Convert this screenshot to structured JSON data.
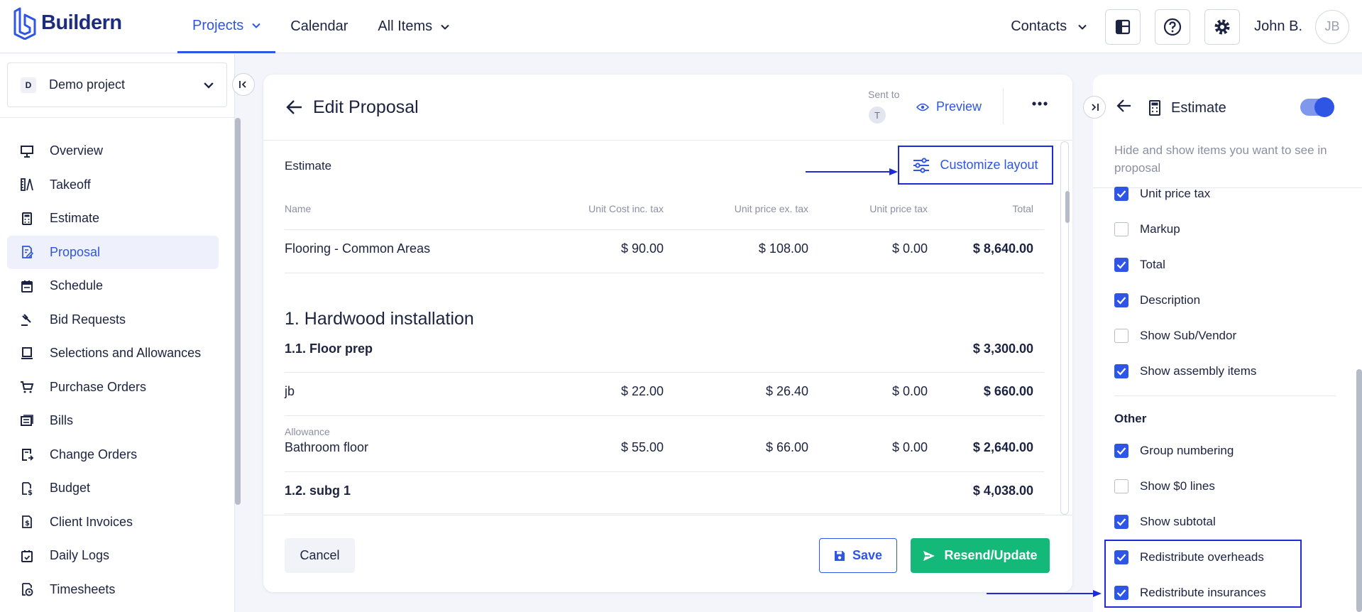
{
  "brand": {
    "name": "Buildern",
    "color": "#1d2d7c"
  },
  "nav": {
    "projects": "Projects",
    "calendar": "Calendar",
    "all_items": "All Items",
    "contacts": "Contacts",
    "user_name": "John B.",
    "user_initials": "JB"
  },
  "sidebar": {
    "project_badge": "D",
    "project_name": "Demo project",
    "items": [
      {
        "label": "Overview",
        "icon": "board-icon"
      },
      {
        "label": "Takeoff",
        "icon": "ruler-icon"
      },
      {
        "label": "Estimate",
        "icon": "calculator-icon"
      },
      {
        "label": "Proposal",
        "icon": "document-pen-icon",
        "active": true
      },
      {
        "label": "Schedule",
        "icon": "calendar-icon"
      },
      {
        "label": "Bid Requests",
        "icon": "gavel-icon"
      },
      {
        "label": "Selections and Allowances",
        "icon": "selection-icon"
      },
      {
        "label": "Purchase Orders",
        "icon": "cart-icon"
      },
      {
        "label": "Bills",
        "icon": "bills-icon"
      },
      {
        "label": "Change Orders",
        "icon": "change-order-icon"
      },
      {
        "label": "Budget",
        "icon": "budget-icon"
      },
      {
        "label": "Client Invoices",
        "icon": "invoice-icon"
      },
      {
        "label": "Daily Logs",
        "icon": "daily-log-icon"
      },
      {
        "label": "Timesheets",
        "icon": "timesheet-icon"
      }
    ]
  },
  "proposal": {
    "title": "Edit Proposal",
    "sent_to_label": "Sent to",
    "sent_to_initial": "T",
    "preview": "Preview",
    "section": "Estimate",
    "customize_layout": "Customize layout",
    "columns": [
      "Name",
      "Unit Cost inc. tax",
      "Unit price ex. tax",
      "Unit price tax",
      "Total"
    ],
    "first_row": {
      "name": "Flooring - Common Areas",
      "unit_cost": "$ 90.00",
      "unit_price_ex": "$ 108.00",
      "unit_tax": "$ 0.00",
      "total": "$ 8,640.00"
    },
    "group_title": "1. Hardwood installation",
    "subgroup1": {
      "name": "1.1. Floor prep",
      "total": "$ 3,300.00"
    },
    "row_jb": {
      "name": "jb",
      "unit_cost": "$ 22.00",
      "unit_price_ex": "$ 26.40",
      "unit_tax": "$ 0.00",
      "total": "$ 660.00"
    },
    "row_bath": {
      "note": "Allowance",
      "name": "Bathroom floor",
      "unit_cost": "$ 55.00",
      "unit_price_ex": "$ 66.00",
      "unit_tax": "$ 0.00",
      "total": "$ 2,640.00"
    },
    "subgroup2": {
      "name": "1.2. subg 1",
      "total": "$ 4,038.00"
    },
    "cancel": "Cancel",
    "save": "Save",
    "resend": "Resend/Update"
  },
  "panel": {
    "title": "Estimate",
    "description": "Hide and show items you want to see in proposal",
    "options": [
      {
        "label": "Unit price tax",
        "checked": true
      },
      {
        "label": "Markup",
        "checked": false
      },
      {
        "label": "Total",
        "checked": true
      },
      {
        "label": "Description",
        "checked": true
      },
      {
        "label": "Show Sub/Vendor",
        "checked": false
      },
      {
        "label": "Show assembly items",
        "checked": true
      }
    ],
    "other_heading": "Other",
    "other_options": [
      {
        "label": "Group numbering",
        "checked": true
      },
      {
        "label": "Show $0 lines",
        "checked": false
      },
      {
        "label": "Show subtotal",
        "checked": true
      },
      {
        "label": "Redistribute overheads",
        "checked": true
      },
      {
        "label": "Redistribute insurances",
        "checked": true
      }
    ]
  },
  "colors": {
    "accent": "#2f55e4",
    "success": "#14b97a",
    "annotation": "#1f2bd8"
  }
}
